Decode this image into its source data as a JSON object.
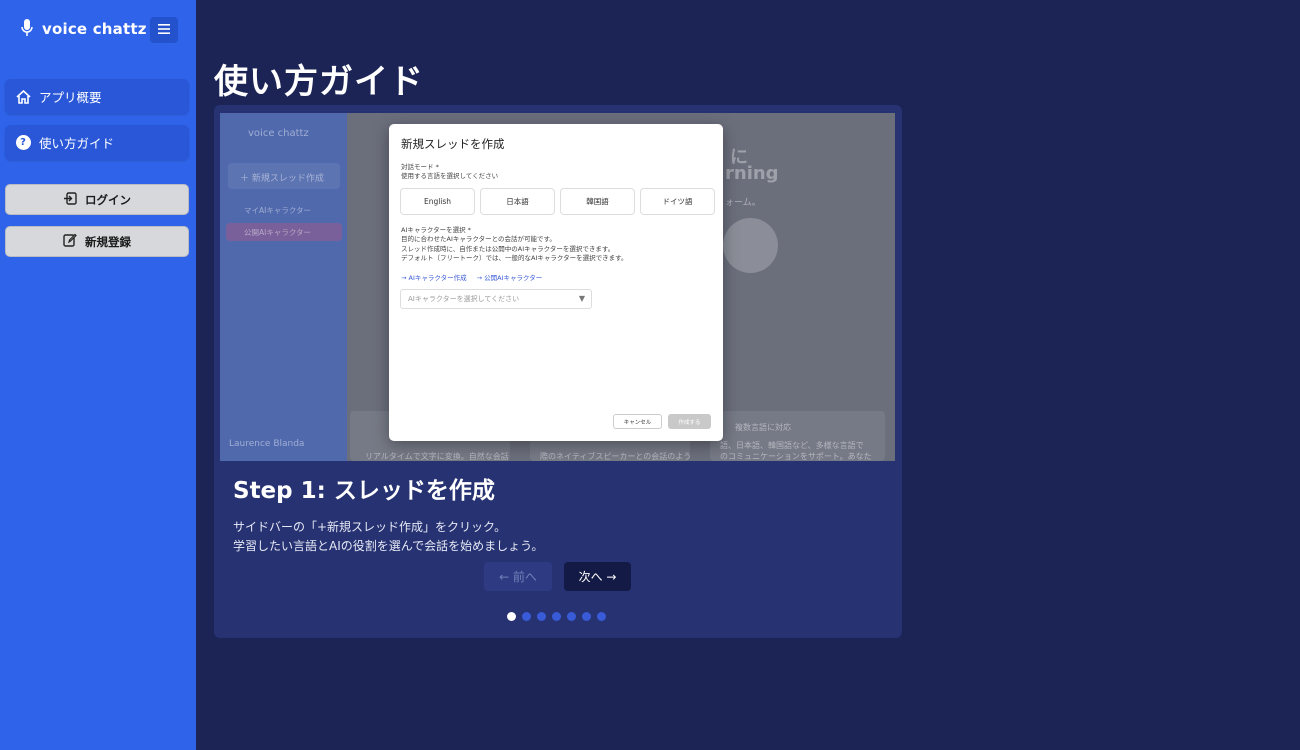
{
  "app": {
    "name": "voice chattz"
  },
  "sidebar": {
    "items": [
      {
        "label": "アプリ概要",
        "icon": "home-icon"
      },
      {
        "label": "使い方ガイド",
        "icon": "help-icon"
      }
    ],
    "login_label": "ログイン",
    "signup_label": "新規登録"
  },
  "page": {
    "title": "使い方ガイド"
  },
  "screenshot": {
    "bg_app_name": "voice chattz",
    "bg_new_thread": "＋ 新規スレッド作成",
    "bg_my_ai": "マイAIキャラクター",
    "bg_public_ai": "公開AIキャラクター",
    "bg_user": "Laurence Blanda",
    "bg_hero_1": "に",
    "bg_hero_2": "rning",
    "bg_hero_3": "ォーム。",
    "bg_feature": "複数言語に対応",
    "bg_feature_text": "語、日本語、韓国語など、多様な言語で",
    "bg_feature_text2": "のコミュニケーションをサポート。あなた",
    "bg_left_text": "リアルタイムで文字に変換。自然な会話",
    "bg_mid_text": "際のネイティブスピーカーとの会話のよう",
    "modal": {
      "title": "新規スレッドを作成",
      "mode_label": "対話モード *",
      "mode_help": "使用する言語を選択してください",
      "languages": [
        "English",
        "日本語",
        "韓国語",
        "ドイツ語"
      ],
      "ai_label": "AIキャラクターを選択 *",
      "ai_help_1": "目的に合わせたAIキャラクターとの会話が可能です。",
      "ai_help_2": "スレッド作成時に、自作または公開中のAIキャラクターを選択できます。",
      "ai_help_3": "デフォルト（フリートーク）では、一般的なAIキャラクターを選択できます。",
      "link_create": "→ AIキャラクター作成",
      "link_public": "→ 公開AIキャラクター",
      "select_placeholder": "AIキャラクターを選択してください",
      "cancel": "キャンセル",
      "create": "作成する"
    }
  },
  "step": {
    "title": "Step 1: スレッドを作成",
    "desc_1": "サイドバーの「+新規スレッド作成」をクリック。",
    "desc_2": "学習したい言語とAIの役割を選んで会話を始めましょう。"
  },
  "nav": {
    "prev": "← 前へ",
    "next": "次へ →"
  },
  "pagination": {
    "total": 7,
    "current": 1
  }
}
